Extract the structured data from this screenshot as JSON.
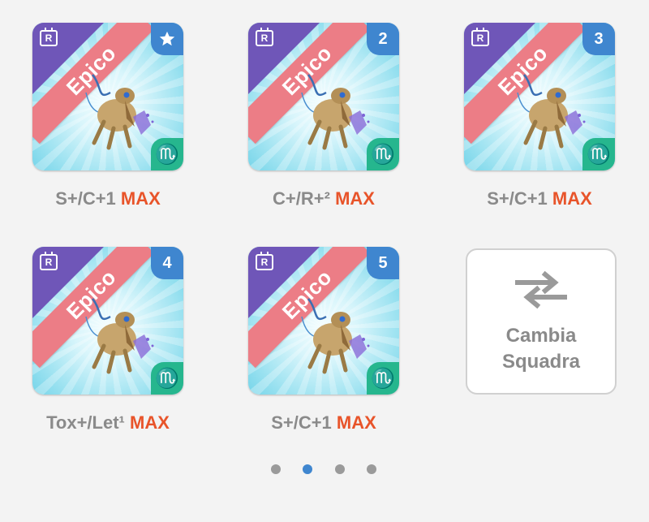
{
  "cards": [
    {
      "rarity": "Epico",
      "badge": "R",
      "corner": "star",
      "zodiac": "♏",
      "caption_prefix": "S+/C+1",
      "caption_max": "MAX"
    },
    {
      "rarity": "Epico",
      "badge": "R",
      "corner": "2",
      "zodiac": "♏",
      "caption_prefix": "C+/R+²",
      "caption_max": "MAX"
    },
    {
      "rarity": "Epico",
      "badge": "R",
      "corner": "3",
      "zodiac": "♏",
      "caption_prefix": "S+/C+1",
      "caption_max": "MAX"
    },
    {
      "rarity": "Epico",
      "badge": "R",
      "corner": "4",
      "zodiac": "♏",
      "caption_prefix": "Tox+/Let¹",
      "caption_max": "MAX"
    },
    {
      "rarity": "Epico",
      "badge": "R",
      "corner": "5",
      "zodiac": "♏",
      "caption_prefix": "S+/C+1",
      "caption_max": "MAX"
    }
  ],
  "swap": {
    "line1": "Cambia",
    "line2": "Squadra",
    "icon": "swap-arrows-icon"
  },
  "pagination": {
    "total": 4,
    "active": 2
  },
  "colors": {
    "ribbon": "#ec7d86",
    "corner_purple": "#6f56b8",
    "number_badge": "#3f86cf",
    "zodiac_badge": "#26b68e",
    "max_text": "#e8542a",
    "caption_text": "#8a8a8a",
    "active_dot": "#3f86cf"
  }
}
